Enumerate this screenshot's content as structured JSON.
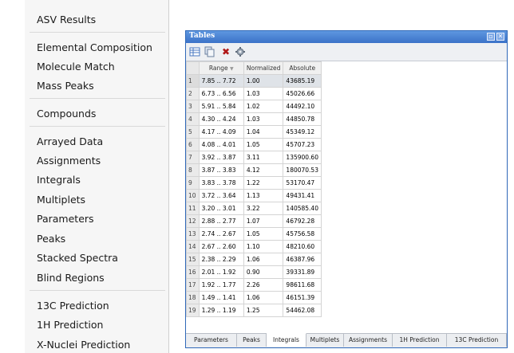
{
  "menu": {
    "items": [
      {
        "label": "ASV Results"
      },
      {
        "label": "Elemental Composition"
      },
      {
        "label": "Molecule Match"
      },
      {
        "label": "Mass Peaks"
      },
      {
        "label": "Compounds"
      },
      {
        "label": "Arrayed Data"
      },
      {
        "label": "Assignments"
      },
      {
        "label": "Integrals"
      },
      {
        "label": "Multiplets"
      },
      {
        "label": "Parameters"
      },
      {
        "label": "Peaks"
      },
      {
        "label": "Stacked Spectra"
      },
      {
        "label": "Blind Regions"
      },
      {
        "label": "13C Prediction"
      },
      {
        "label": "1H Prediction"
      },
      {
        "label": "X-Nuclei Prediction"
      }
    ]
  },
  "window": {
    "title": "Tables",
    "toolbar_icons": [
      "table-icon",
      "copy-icon",
      "delete-icon",
      "settings-icon"
    ],
    "columns": [
      "",
      "Range",
      "Normalized",
      "Absolute"
    ],
    "rows": [
      [
        "1",
        "7.85 .. 7.72",
        "1.00",
        "43685.19"
      ],
      [
        "2",
        "6.73 .. 6.56",
        "1.03",
        "45026.66"
      ],
      [
        "3",
        "5.91 .. 5.84",
        "1.02",
        "44492.10"
      ],
      [
        "4",
        "4.30 .. 4.24",
        "1.03",
        "44850.78"
      ],
      [
        "5",
        "4.17 .. 4.09",
        "1.04",
        "45349.12"
      ],
      [
        "6",
        "4.08 .. 4.01",
        "1.05",
        "45707.23"
      ],
      [
        "7",
        "3.92 .. 3.87",
        "3.11",
        "135900.60"
      ],
      [
        "8",
        "3.87 .. 3.83",
        "4.12",
        "180070.53"
      ],
      [
        "9",
        "3.83 .. 3.78",
        "1.22",
        "53170.47"
      ],
      [
        "10",
        "3.72 .. 3.64",
        "1.13",
        "49431.41"
      ],
      [
        "11",
        "3.20 .. 3.01",
        "3.22",
        "140585.40"
      ],
      [
        "12",
        "2.88 .. 2.77",
        "1.07",
        "46792.28"
      ],
      [
        "13",
        "2.74 .. 2.67",
        "1.05",
        "45756.58"
      ],
      [
        "14",
        "2.67 .. 2.60",
        "1.10",
        "48210.60"
      ],
      [
        "15",
        "2.38 .. 2.29",
        "1.06",
        "46387.96"
      ],
      [
        "16",
        "2.01 .. 1.92",
        "0.90",
        "39331.89"
      ],
      [
        "17",
        "1.92 .. 1.77",
        "2.26",
        "98611.68"
      ],
      [
        "18",
        "1.49 .. 1.41",
        "1.06",
        "46151.39"
      ],
      [
        "19",
        "1.29 .. 1.19",
        "1.25",
        "54462.08"
      ]
    ],
    "tabs": [
      "Parameters",
      "Peaks",
      "Integrals",
      "Multiplets",
      "Assignments",
      "1H Prediction",
      "13C Prediction"
    ],
    "active_tab": "Integrals"
  },
  "colors": {
    "titlebar": "#3b72c8",
    "selected_row": "#dfe3e8"
  }
}
